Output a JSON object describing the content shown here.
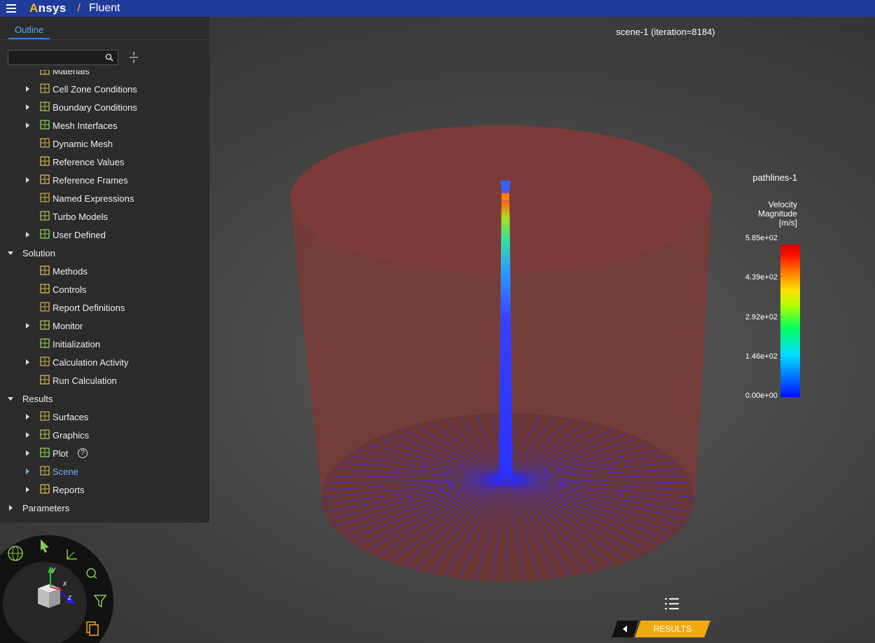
{
  "header": {
    "brand_prefix": "A",
    "brand_rest": "nsys",
    "separator": "/",
    "app_name": "Fluent"
  },
  "outline": {
    "tab_label": "Outline",
    "search_placeholder": "",
    "items": [
      {
        "label": "Materials",
        "expand": "none",
        "icon": "materials-icon",
        "active": false
      },
      {
        "label": "Cell Zone Conditions",
        "expand": "collapsed",
        "icon": "cell-zone-icon",
        "active": false
      },
      {
        "label": "Boundary Conditions",
        "expand": "collapsed",
        "icon": "boundary-icon",
        "active": false
      },
      {
        "label": "Mesh Interfaces",
        "expand": "collapsed",
        "icon": "mesh-interfaces-icon",
        "active": false
      },
      {
        "label": "Dynamic Mesh",
        "expand": "none",
        "icon": "dynamic-mesh-icon",
        "active": false
      },
      {
        "label": "Reference Values",
        "expand": "none",
        "icon": "reference-values-icon",
        "active": false
      },
      {
        "label": "Reference Frames",
        "expand": "collapsed",
        "icon": "reference-frames-icon",
        "active": false
      },
      {
        "label": "Named Expressions",
        "expand": "none",
        "icon": "fx-icon",
        "active": false
      },
      {
        "label": "Turbo Models",
        "expand": "none",
        "icon": "turbo-icon",
        "active": false
      },
      {
        "label": "User Defined",
        "expand": "collapsed",
        "icon": "gears-icon",
        "active": false
      },
      {
        "label": "Solution",
        "expand": "expanded",
        "icon": "",
        "active": false
      },
      {
        "label": "Methods",
        "expand": "none",
        "icon": "methods-icon",
        "active": false
      },
      {
        "label": "Controls",
        "expand": "none",
        "icon": "controls-icon",
        "active": false
      },
      {
        "label": "Report Definitions",
        "expand": "none",
        "icon": "report-definitions-icon",
        "active": false
      },
      {
        "label": "Monitor",
        "expand": "collapsed",
        "icon": "monitor-icon",
        "active": false
      },
      {
        "label": "Initialization",
        "expand": "none",
        "icon": "initialization-icon",
        "active": false
      },
      {
        "label": "Calculation Activity",
        "expand": "collapsed",
        "icon": "calculation-activity-icon",
        "active": false
      },
      {
        "label": "Run Calculation",
        "expand": "none",
        "icon": "run-calculation-icon",
        "active": false
      },
      {
        "label": "Results",
        "expand": "expanded",
        "icon": "",
        "active": false
      },
      {
        "label": "Surfaces",
        "expand": "collapsed",
        "icon": "surfaces-icon",
        "active": false
      },
      {
        "label": "Graphics",
        "expand": "collapsed",
        "icon": "graphics-icon",
        "active": false
      },
      {
        "label": "Plot",
        "expand": "collapsed",
        "icon": "plot-icon",
        "active": false,
        "help": "?"
      },
      {
        "label": "Scene",
        "expand": "collapsed",
        "icon": "scene-icon",
        "active": true
      },
      {
        "label": "Reports",
        "expand": "collapsed",
        "icon": "reports-icon",
        "active": false
      },
      {
        "label": "Parameters",
        "expand": "collapsed",
        "icon": "",
        "active": false
      }
    ]
  },
  "scene": {
    "title": "scene-1 (iteration=8184)",
    "legend_title": "pathlines-1",
    "legend_variable": [
      "Velocity",
      "Magnitude",
      "[m/s]"
    ],
    "ticks": [
      "5.85e+02",
      "4.39e+02",
      "2.92e+02",
      "1.46e+02",
      "0.00e+00"
    ]
  },
  "triad": {
    "x": "x",
    "y": "y",
    "z": "z"
  },
  "results_button": "RESULTS",
  "colors": {
    "header": "#1f3c9b",
    "accent": "#ffb71b",
    "active": "#6cb4ff",
    "results": "#f0a912"
  }
}
